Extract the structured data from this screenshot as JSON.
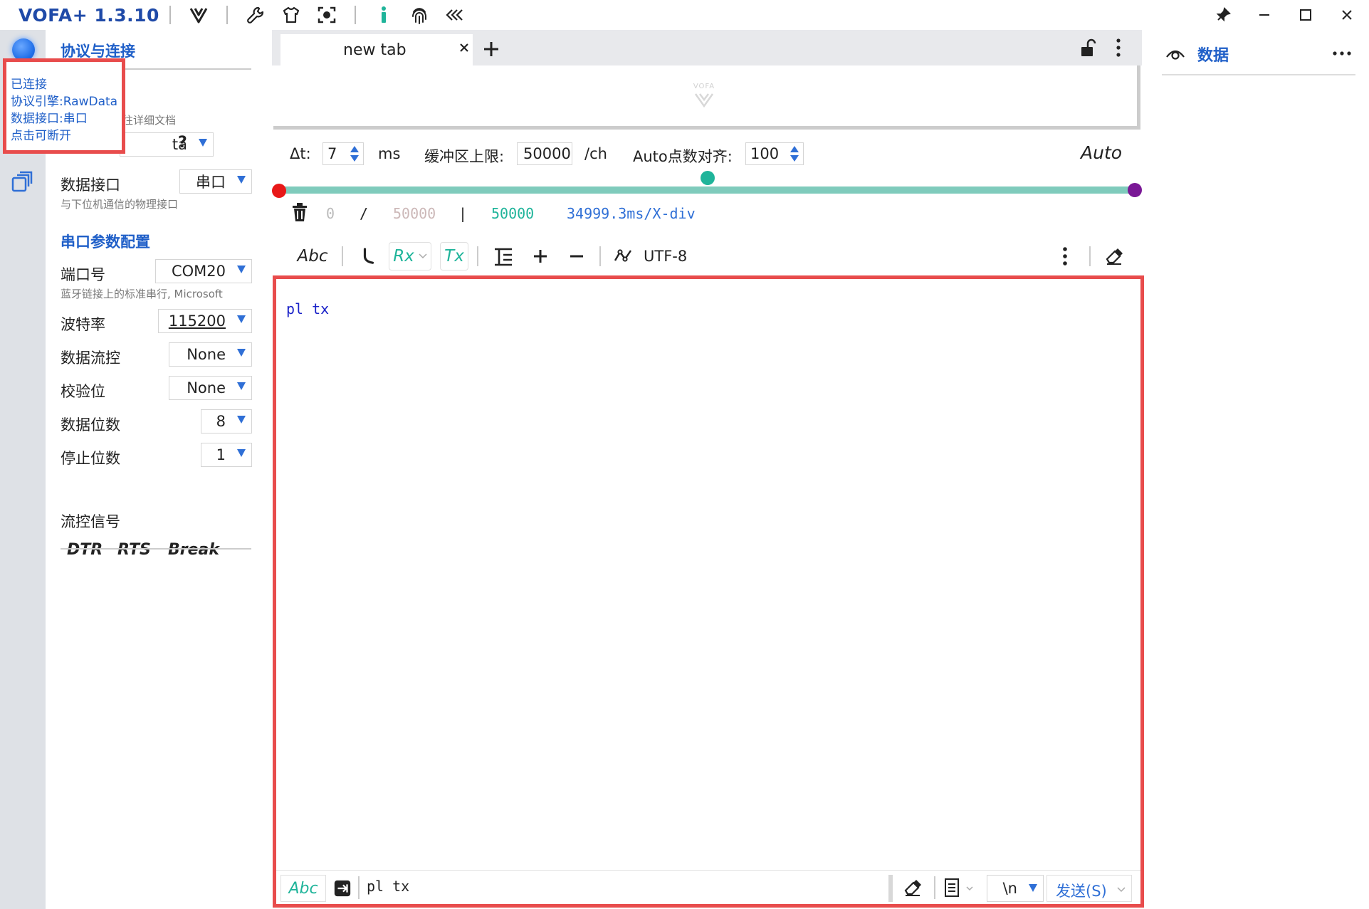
{
  "app": {
    "title": "VOFA+ 1.3.10"
  },
  "left_panel": {
    "section_title": "协议与连接",
    "protocol_doc_hint": "往详细文档",
    "protocol_value": "ta",
    "help": "?",
    "interface": {
      "label": "数据接口",
      "value": "串口",
      "sub": "与下位机通信的物理接口"
    },
    "serial_section_title": "串口参数配置",
    "port": {
      "label": "端口号",
      "value": "COM20",
      "sub": "蓝牙链接上的标准串行, Microsoft"
    },
    "baud": {
      "label": "波特率",
      "value": "115200"
    },
    "flow": {
      "label": "数据流控",
      "value": "None"
    },
    "parity": {
      "label": "校验位",
      "value": "None"
    },
    "databits": {
      "label": "数据位数",
      "value": "8"
    },
    "stopbits": {
      "label": "停止位数",
      "value": "1"
    },
    "flow_signals": {
      "label": "流控信号",
      "dtr": "DTR",
      "rts": "RTS",
      "brk": "Break"
    }
  },
  "tooltip": {
    "line1": "已连接",
    "line2": "协议引擎:RawData",
    "line3": "数据接口:串口",
    "line4": "点击可断开"
  },
  "tabs": {
    "active": "new tab"
  },
  "preview": {
    "logo": "VOFA"
  },
  "params": {
    "dt_label": "Δt:",
    "dt_value": "7",
    "dt_unit": "ms",
    "buffer_label": "缓冲区上限:",
    "buffer_value": "50000",
    "buffer_unit": "/ch",
    "auto_align_label": "Auto点数对齐:",
    "auto_align_value": "100",
    "auto_button": "Auto"
  },
  "stats": {
    "count": "0",
    "slash": "/",
    "max": "50000",
    "bar": "|",
    "window": "50000",
    "xdiv": "34999.3ms/X-div"
  },
  "toolbar": {
    "abc": "Abc",
    "rx": "Rx",
    "tx": "Tx",
    "encoding": "UTF-8"
  },
  "receive": {
    "text": "pl tx"
  },
  "send": {
    "abc": "Abc",
    "input": "pl tx",
    "newline": "\\n",
    "send_button": "发送(S)"
  },
  "right_panel": {
    "title": "数据"
  },
  "colors": {
    "accent": "#1f5fc8",
    "highlight_border": "#e84c4c",
    "teal": "#1fb49a",
    "slider_track": "#7fcbbc",
    "rx_text": "#1a22c8"
  },
  "icons": [
    "v-icon",
    "wrench-icon",
    "shirt-icon",
    "screenshot-icon",
    "info-icon",
    "fingerprint-icon",
    "collapse-icon",
    "pin-icon",
    "minimize-icon",
    "maximize-icon",
    "close-icon",
    "eye-icon",
    "more-icon",
    "trash-icon",
    "eraser-icon",
    "lock-icon"
  ]
}
